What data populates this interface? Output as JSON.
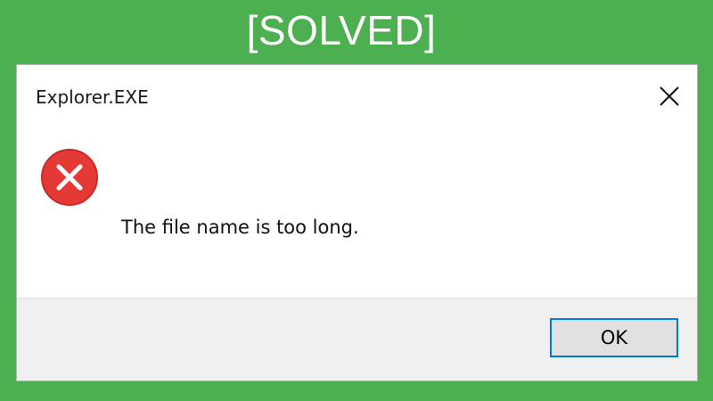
{
  "banner": {
    "text": "[SOLVED]"
  },
  "dialog": {
    "title": "Explorer.EXE",
    "close_icon": "close-icon",
    "error_icon": "error-icon",
    "message": "The file name is too long.",
    "ok_label": "OK"
  },
  "colors": {
    "background": "#4caf50",
    "error": "#e53935",
    "button_focus_border": "#0078d7",
    "footer": "#f0f0f0"
  }
}
